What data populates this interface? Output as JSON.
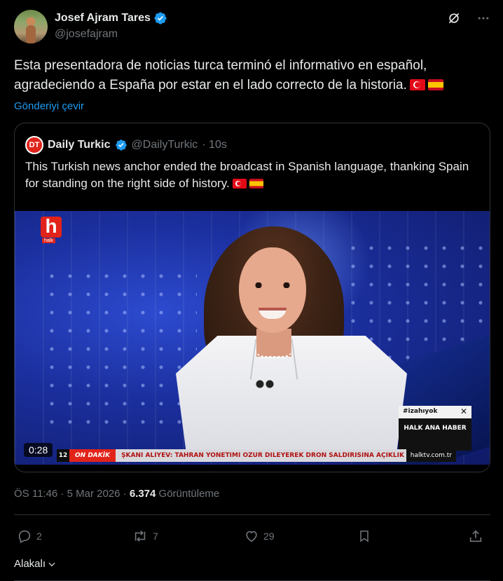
{
  "author": {
    "name": "Josef Ajram Tares",
    "handle": "@josefajram"
  },
  "header_icons": [
    "grok-icon",
    "more-icon"
  ],
  "tweet": {
    "text": "Esta presentadora de noticias turca terminó el informativo en español, agradeciendo a España por estar en el lado correcto de la historia.",
    "flags": [
      "turkey-flag",
      "spain-flag"
    ],
    "translate": "Gönderiyi çevir"
  },
  "quote": {
    "avatar_text": "DT",
    "name": "Daily Turkic",
    "handle": "@DailyTurkic",
    "time": "· 10s",
    "text": "This Turkish news anchor ended the broadcast in Spanish language, thanking Spain for standing on the right side of history.",
    "video": {
      "duration": "0:28",
      "channel_logo": "h",
      "channel_logo_sub": "halk",
      "hashtag": "#izahıyok",
      "program": "HALK ANA HABER",
      "ticker_num": "12",
      "ticker_label": "ON DAKİK",
      "ticker_text": "ŞKANI ALİYEV: TAHRAN YÖNETİMİ ÖZÜR DİLEYEREK DRON SALDIRISINA AÇIKLIK GETİR",
      "ticker_site": "halktv.com.tr"
    }
  },
  "meta": {
    "time_date": "ÖS 11:46 · 5 Mar 2026 ·",
    "views": "6.374",
    "views_label": "Görüntüleme"
  },
  "actions": {
    "replies": "2",
    "reposts": "7",
    "likes": "29"
  },
  "sort_label": "Alakalı",
  "colors": {
    "background": "#000000",
    "text": "#e7e9ea",
    "muted": "#71767b",
    "accent": "#1d9bf0",
    "border": "#2f3336"
  }
}
